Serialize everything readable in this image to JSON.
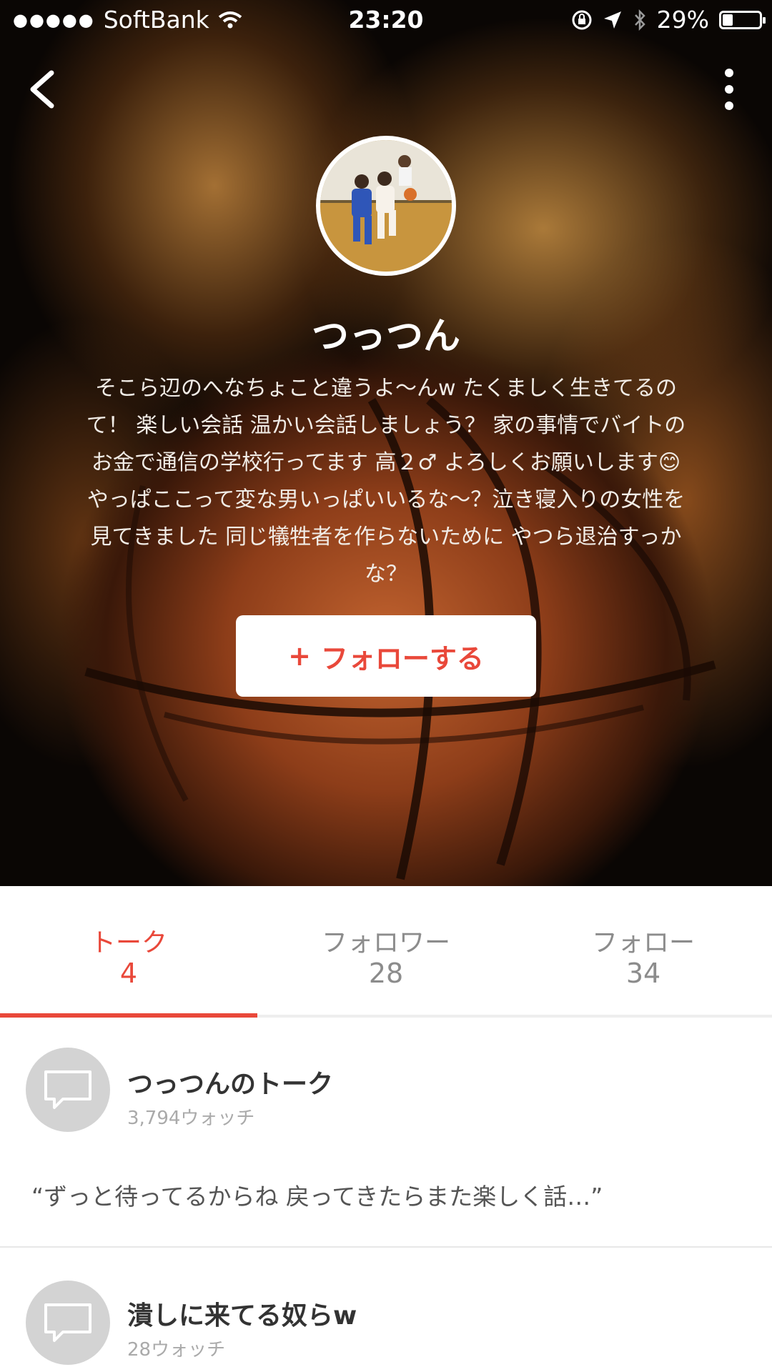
{
  "status_bar": {
    "carrier_dots": "●●●●●",
    "carrier": "SoftBank",
    "time": "23:20",
    "battery": "29%",
    "battery_level": 0.29
  },
  "profile": {
    "name": "つっつん",
    "bio": "そこら辺のへなちょこと違うよ〜んw たくましく生きてるのて！ 楽しい会話 温かい会話しましょう？ 家の事情でバイトのお金で通信の学校行ってます 高２♂ よろしくお願いします😊 やっぱここって変な男いっぱいいるな〜？泣き寝入りの女性を見てきました 同じ犠牲者を作らないために やつら退治すっかな？",
    "follow_label": "フォローする",
    "follow_icon": "+"
  },
  "tabs": [
    {
      "label": "トーク",
      "count": "4"
    },
    {
      "label": "フォロワー",
      "count": "28"
    },
    {
      "label": "フォロー",
      "count": "34"
    }
  ],
  "talks": [
    {
      "title": "つっつんのトーク",
      "watch": "3,794ウォッチ",
      "quote": "“ずっと待ってるからね 戻ってきたらまた楽しく話…”"
    },
    {
      "title": "潰しに来てる奴らw",
      "watch": "28ウォッチ"
    }
  ],
  "colors": {
    "accent": "#e9483a"
  }
}
